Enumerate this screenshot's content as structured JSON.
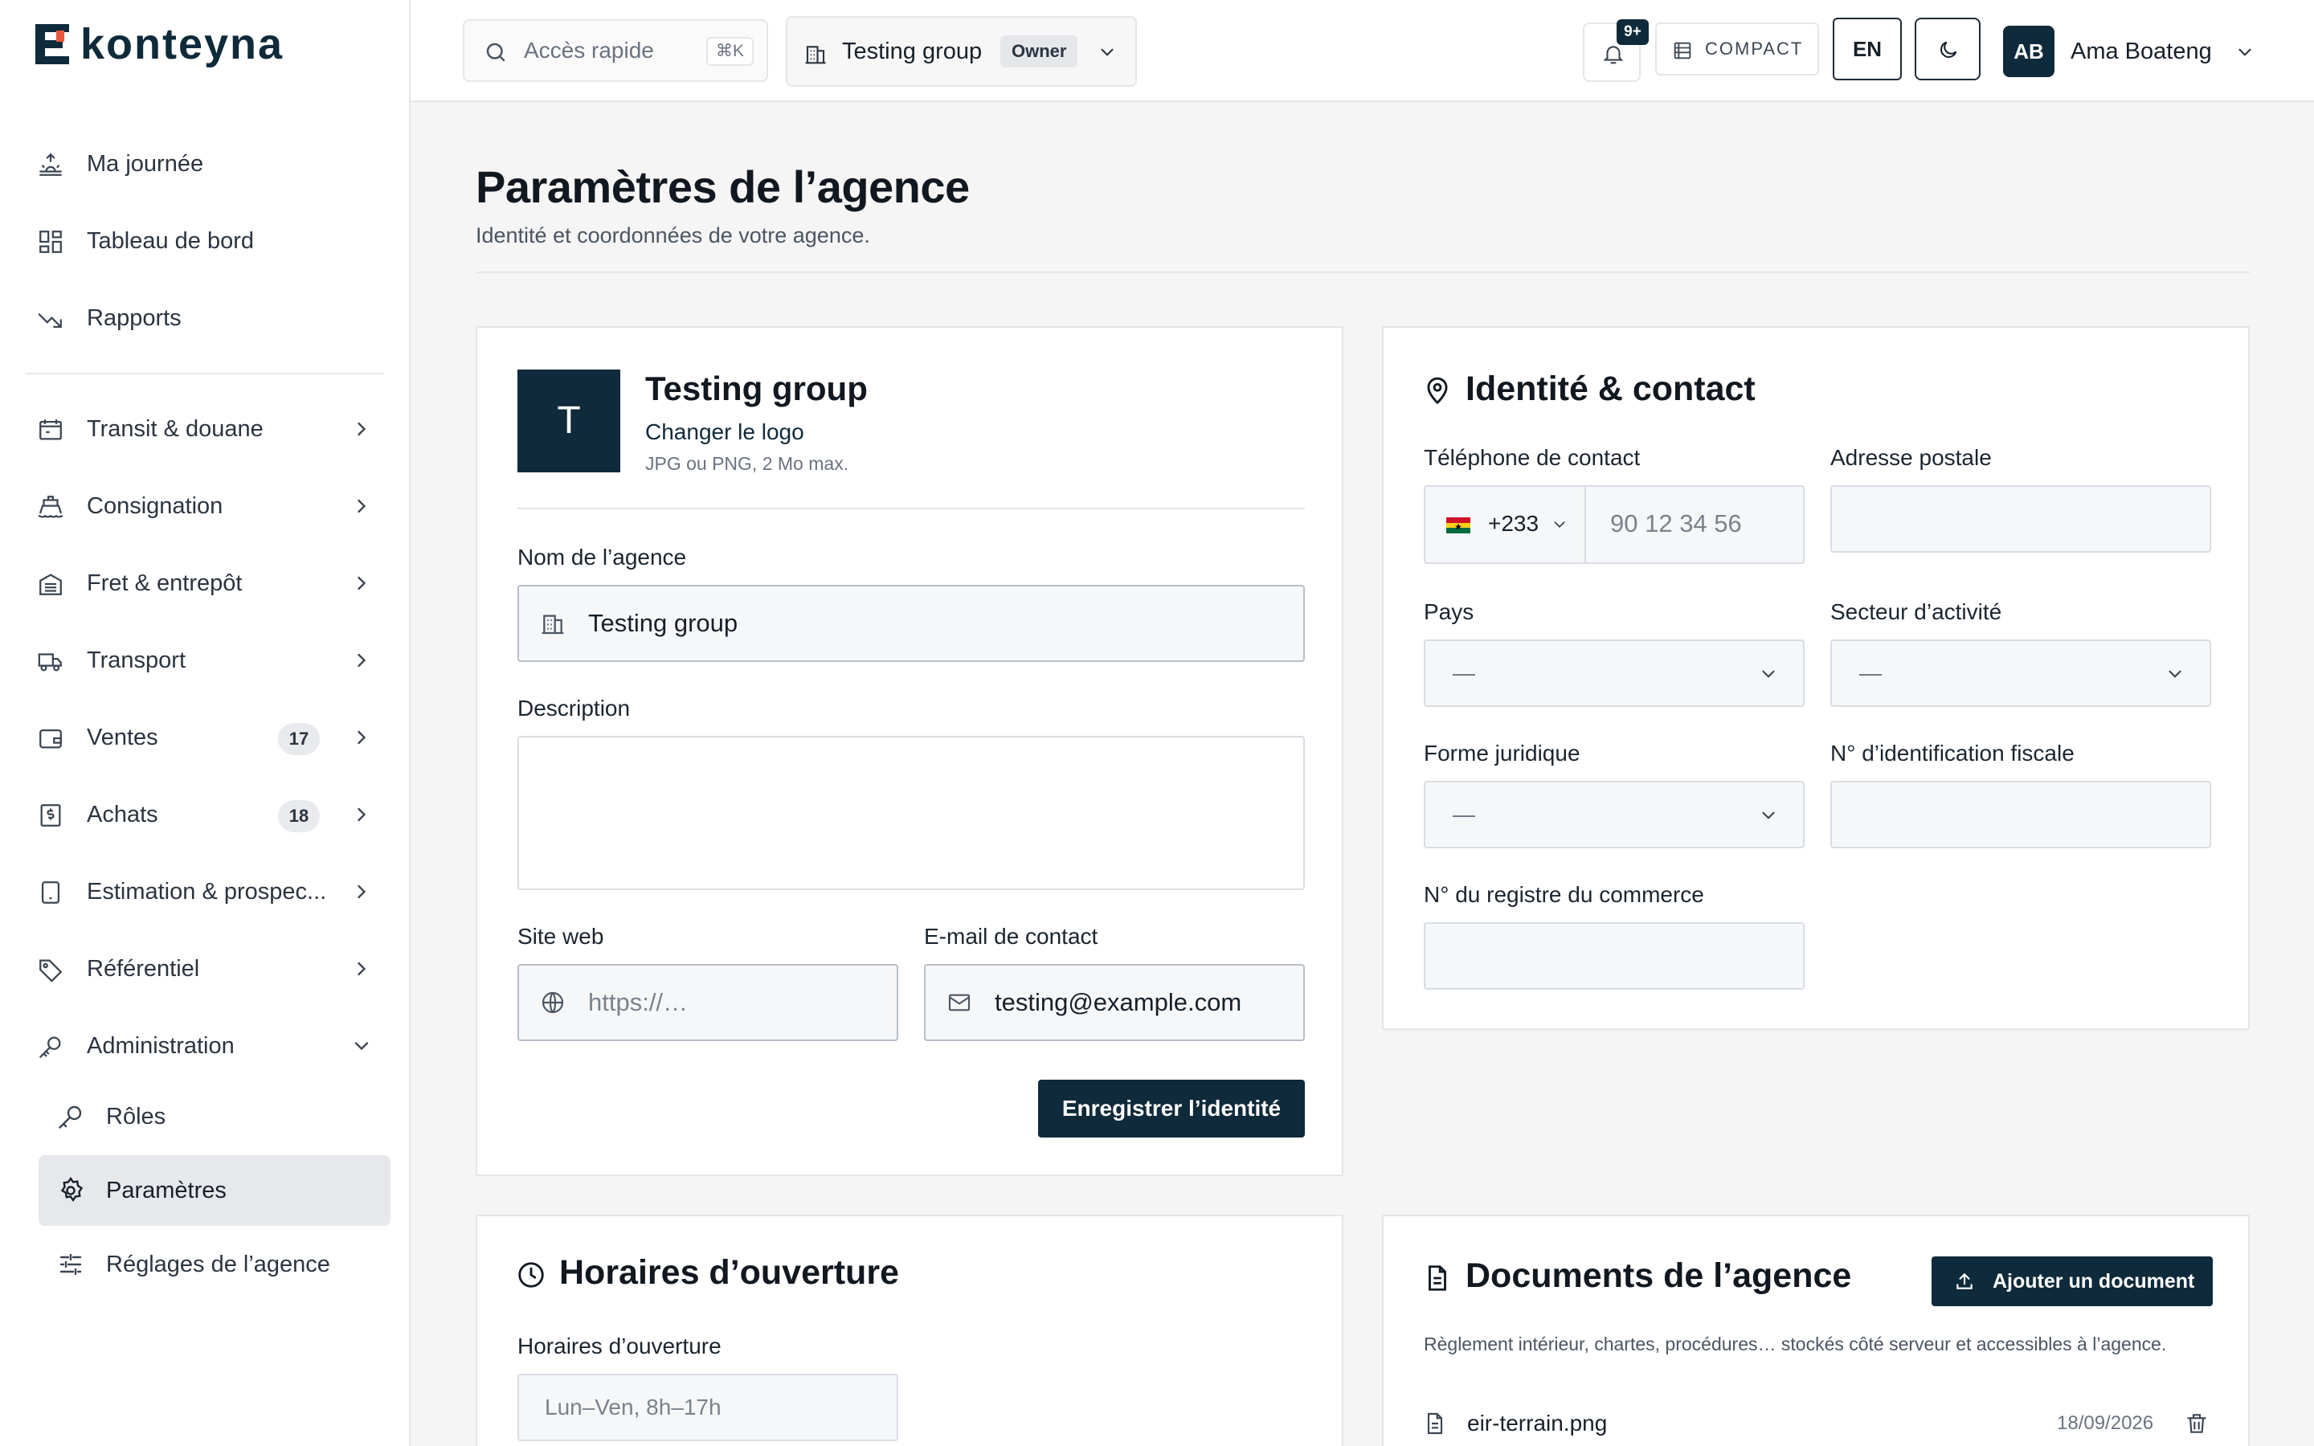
{
  "brand": {
    "name": "konteyna"
  },
  "sidebar": {
    "top_items": [
      {
        "label": "Ma journée"
      },
      {
        "label": "Tableau de bord"
      },
      {
        "label": "Rapports"
      }
    ],
    "modules": [
      {
        "label": "Transit & douane"
      },
      {
        "label": "Consignation"
      },
      {
        "label": "Fret & entrepôt"
      },
      {
        "label": "Transport"
      },
      {
        "label": "Ventes",
        "badge": "17"
      },
      {
        "label": "Achats",
        "badge": "18"
      },
      {
        "label": "Estimation & prospec..."
      },
      {
        "label": "Référentiel"
      },
      {
        "label": "Administration"
      }
    ],
    "admin_sub": [
      {
        "label": "Rôles"
      },
      {
        "label": "Paramètres"
      },
      {
        "label": "Réglages de l’agence"
      }
    ]
  },
  "topbar": {
    "quick_access": "Accès rapide",
    "shortcut": "⌘K",
    "org_name": "Testing group",
    "org_role": "Owner",
    "notif_count": "9+",
    "compact_label": "COMPACT",
    "lang": "EN",
    "user_initials": "AB",
    "user_name": "Ama Boateng"
  },
  "page": {
    "title": "Paramètres de l’agence",
    "subtitle": "Identité et coordonnées de votre agence."
  },
  "identity_card": {
    "logo_letter": "T",
    "agency_name": "Testing group",
    "change_logo": "Changer le logo",
    "logo_hint": "JPG ou PNG, 2 Mo max.",
    "name_label": "Nom de l’agence",
    "name_value": "Testing group",
    "description_label": "Description",
    "description_value": "",
    "website_label": "Site web",
    "website_placeholder": "https://…",
    "email_label": "E-mail de contact",
    "email_value": "testing@example.com",
    "save_button": "Enregistrer l’identité"
  },
  "contact_card": {
    "title": "Identité & contact",
    "phone_label": "Téléphone de contact",
    "phone_code": "+233",
    "phone_placeholder": "90 12 34 56",
    "address_label": "Adresse postale",
    "country_label": "Pays",
    "country_value": "—",
    "sector_label": "Secteur d’activité",
    "sector_value": "—",
    "legal_form_label": "Forme juridique",
    "legal_form_value": "—",
    "tax_id_label": "N° d’identification fiscale",
    "trade_register_label": "N° du registre du commerce"
  },
  "hours_card": {
    "title": "Horaires d’ouverture",
    "hours_label": "Horaires d’ouverture",
    "hours_placeholder": "Lun–Ven, 8h–17h"
  },
  "documents_card": {
    "title": "Documents de l’agence",
    "add_button": "Ajouter un document",
    "description": "Règlement intérieur, chartes, procédures… stockés côté serveur et accessibles à l’agence.",
    "files": [
      {
        "name": "eir-terrain.png",
        "date": "18/09/2026"
      }
    ]
  },
  "colors": {
    "brand_dark": "#0f2a3a",
    "background": "#f5f5f5",
    "border": "#e3e6ea"
  }
}
